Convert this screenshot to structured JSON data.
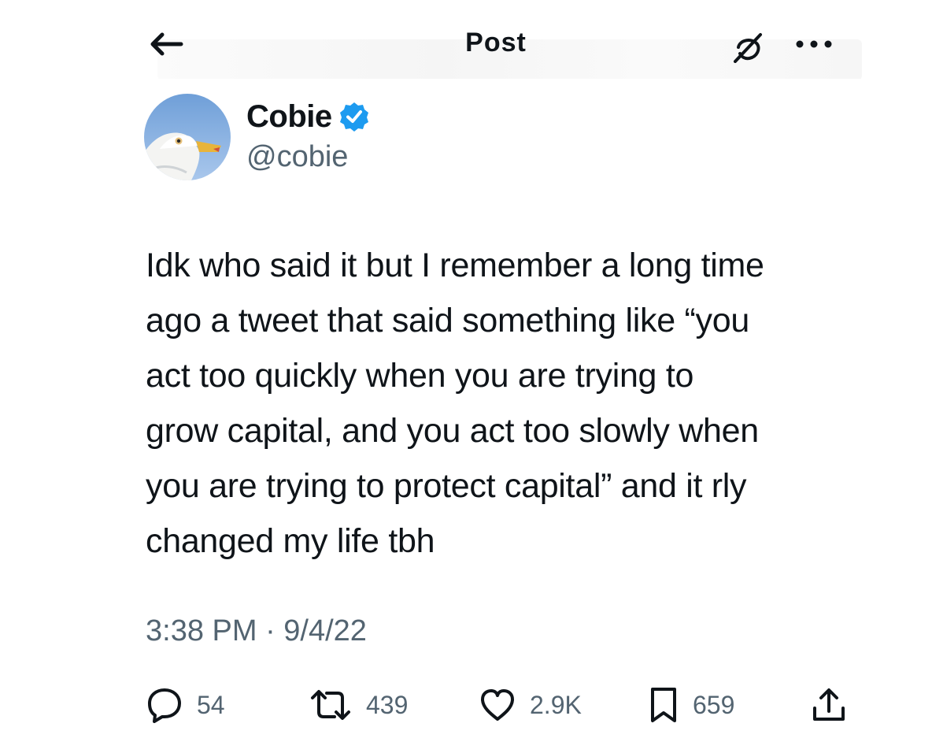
{
  "header": {
    "title": "Post"
  },
  "author": {
    "name": "Cobie",
    "handle": "@cobie",
    "verified": true,
    "avatar_icon": "seagull-avatar"
  },
  "tweet": {
    "lines": [
      "Idk who said it but I remember a long time",
      "ago a tweet that said something like “you",
      "act too quickly when you are trying to",
      "grow capital, and you act too slowly when",
      "you are trying to protect capital” and it rly",
      "changed my life tbh"
    ],
    "timestamp": "3:38 PM · 9/4/22"
  },
  "actions": {
    "replies": "54",
    "reposts": "439",
    "likes": "2.9K",
    "bookmarks": "659"
  },
  "colors": {
    "text": "#0f1419",
    "secondary": "#536471",
    "verified": "#1d9bf0"
  }
}
